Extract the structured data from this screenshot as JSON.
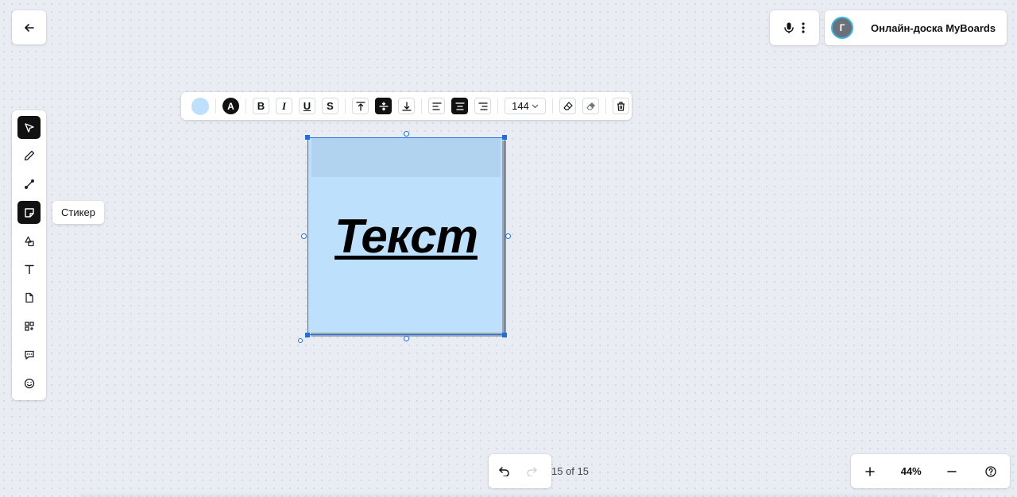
{
  "header": {
    "board_title": "Онлайн-доска MyBoards",
    "avatar_initial": "Г"
  },
  "left_toolbar": {
    "tools": [
      {
        "name": "select",
        "icon": "cursor-arrow-icon",
        "active": true
      },
      {
        "name": "pen",
        "icon": "pencil-icon",
        "active": false
      },
      {
        "name": "connector",
        "icon": "connector-line-icon",
        "active": false
      },
      {
        "name": "sticker",
        "icon": "sticker-icon",
        "active": true
      },
      {
        "name": "shapes",
        "icon": "shapes-icon",
        "active": false
      },
      {
        "name": "text",
        "icon": "text-icon",
        "active": false
      },
      {
        "name": "file",
        "icon": "file-icon",
        "active": false
      },
      {
        "name": "apps",
        "icon": "apps-grid-icon",
        "active": false
      },
      {
        "name": "comment",
        "icon": "comment-icon",
        "active": false
      },
      {
        "name": "emoji",
        "icon": "emoji-icon",
        "active": false
      }
    ],
    "tooltip": "Стикер"
  },
  "format_toolbar": {
    "fill_color": "#bde0fc",
    "font_color_label": "A",
    "bold_label": "B",
    "italic_label": "I",
    "underline_label": "U",
    "strike_label": "S",
    "font_size": "144"
  },
  "sticker": {
    "text": "Текст",
    "color": "#bde0fc"
  },
  "footer": {
    "page_counter": "15 of 15",
    "zoom_level": "44%"
  },
  "colors": {
    "selection": "#1d6fe3",
    "canvas_bg": "#e9ecf3",
    "active_tool": "#111111"
  }
}
